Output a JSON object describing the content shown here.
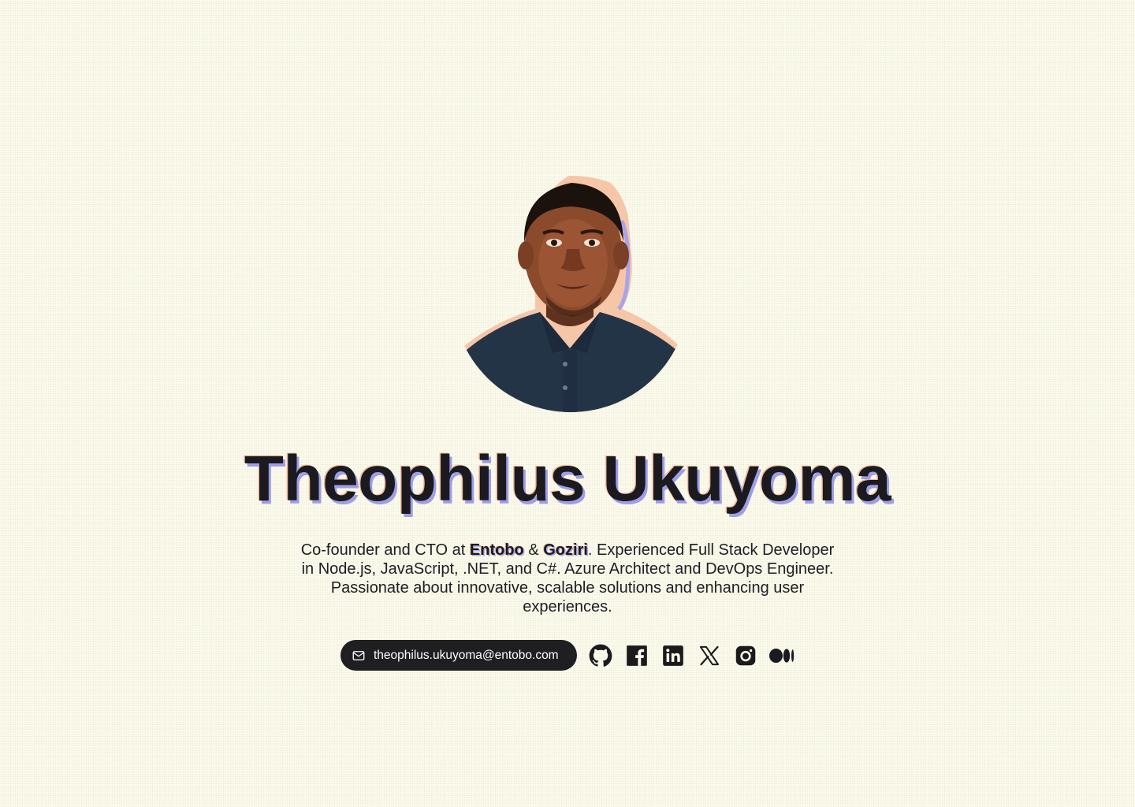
{
  "profile": {
    "name": "Theophilus Ukuyoma",
    "avatar_alt": "Theophilus Ukuyoma portrait"
  },
  "bio": {
    "prefix": "Co-founder and CTO at ",
    "company_1": "Entobo",
    "joiner": " & ",
    "company_2": "Goziri",
    "rest": ". Experienced Full Stack Developer in Node.js, JavaScript, .NET, and C#. Azure Architect and DevOps Engineer. Passionate about innovative, scalable solutions and enhancing user experiences."
  },
  "contact": {
    "email": "theophilus.ukuyoma@entobo.com",
    "email_icon": "mail-icon"
  },
  "socials": [
    {
      "name": "GitHub",
      "icon": "github-icon"
    },
    {
      "name": "Facebook",
      "icon": "facebook-icon"
    },
    {
      "name": "LinkedIn",
      "icon": "linkedin-icon"
    },
    {
      "name": "X",
      "icon": "x-icon"
    },
    {
      "name": "Instagram",
      "icon": "instagram-icon"
    },
    {
      "name": "Medium",
      "icon": "medium-icon"
    }
  ],
  "colors": {
    "background": "#fbfaeb",
    "text": "#1b1a1f",
    "pill": "#1f1f21",
    "accent_purple": "#9f9de6",
    "accent_peach": "#f2b89b"
  }
}
